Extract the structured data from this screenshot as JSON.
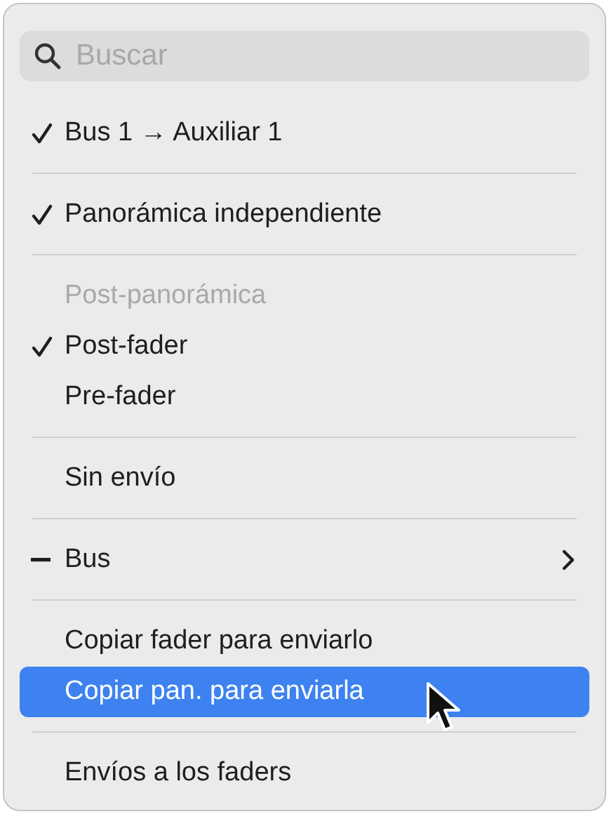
{
  "search": {
    "placeholder": "Buscar"
  },
  "items": [
    {
      "kind": "item",
      "label": "Bus 1 → Auxiliar 1",
      "checked": true,
      "mixed": false,
      "disabled": false,
      "selected": false,
      "submenu": false
    },
    {
      "kind": "separator"
    },
    {
      "kind": "item",
      "label": "Panorámica independiente",
      "checked": true,
      "mixed": false,
      "disabled": false,
      "selected": false,
      "submenu": false
    },
    {
      "kind": "separator"
    },
    {
      "kind": "item",
      "label": "Post-panorámica",
      "checked": false,
      "mixed": false,
      "disabled": true,
      "selected": false,
      "submenu": false
    },
    {
      "kind": "item",
      "label": "Post-fader",
      "checked": true,
      "mixed": false,
      "disabled": false,
      "selected": false,
      "submenu": false
    },
    {
      "kind": "item",
      "label": "Pre-fader",
      "checked": false,
      "mixed": false,
      "disabled": false,
      "selected": false,
      "submenu": false
    },
    {
      "kind": "separator"
    },
    {
      "kind": "item",
      "label": "Sin envío",
      "checked": false,
      "mixed": false,
      "disabled": false,
      "selected": false,
      "submenu": false
    },
    {
      "kind": "separator"
    },
    {
      "kind": "item",
      "label": "Bus",
      "checked": false,
      "mixed": true,
      "disabled": false,
      "selected": false,
      "submenu": true
    },
    {
      "kind": "separator"
    },
    {
      "kind": "item",
      "label": "Copiar fader para enviarlo",
      "checked": false,
      "mixed": false,
      "disabled": false,
      "selected": false,
      "submenu": false
    },
    {
      "kind": "item",
      "label": "Copiar pan. para enviarla",
      "checked": false,
      "mixed": false,
      "disabled": false,
      "selected": true,
      "submenu": false
    },
    {
      "kind": "separator"
    },
    {
      "kind": "item",
      "label": "Envíos a los faders",
      "checked": false,
      "mixed": false,
      "disabled": false,
      "selected": false,
      "submenu": false
    }
  ]
}
